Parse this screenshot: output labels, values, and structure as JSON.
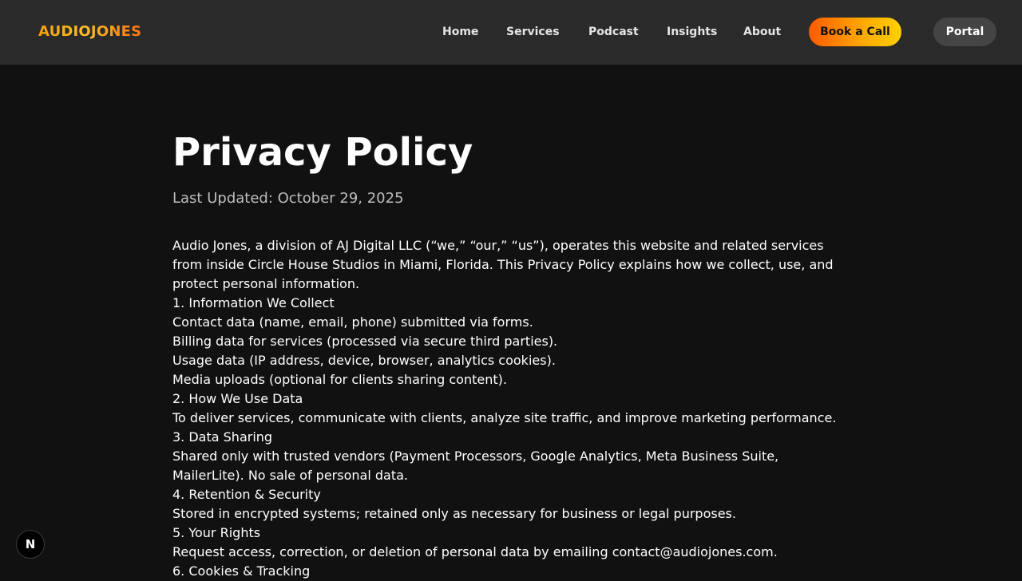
{
  "header": {
    "logo": "AUDIOJONES",
    "nav": {
      "home": "Home",
      "services": "Services",
      "podcast": "Podcast",
      "insights": "Insights",
      "about": "About"
    },
    "book_call": "Book a Call",
    "portal": "Portal"
  },
  "page": {
    "title": "Privacy Policy",
    "last_updated": "Last Updated: October 29, 2025",
    "intro": "Audio Jones, a division of AJ Digital LLC (“we,” “our,” “us”), operates this website and related services from inside Circle House Studios in Miami, Florida. This Privacy Policy explains how we collect, use, and protect personal information.",
    "s1_heading": "1. Information We Collect",
    "s1_line1": "Contact data (name, email, phone) submitted via forms.",
    "s1_line2": "Billing data for services (processed via secure third parties).",
    "s1_line3": "Usage data (IP address, device, browser, analytics cookies).",
    "s1_line4": "Media uploads (optional for clients sharing content).",
    "s2_heading": "2. How We Use Data",
    "s2_body": "To deliver services, communicate with clients, analyze site traffic, and improve marketing performance.",
    "s3_heading": "3. Data Sharing",
    "s3_body": "Shared only with trusted vendors (Payment Processors, Google Analytics, Meta Business Suite, MailerLite). No sale of personal data.",
    "s4_heading": "4. Retention & Security",
    "s4_body": "Stored in encrypted systems; retained only as necessary for business or legal purposes.",
    "s5_heading": "5. Your Rights",
    "s5_body": "Request access, correction, or deletion of personal data by emailing contact@audiojones.com.",
    "s6_heading": "6. Cookies & Tracking"
  },
  "dev_badge": "N",
  "colors": {
    "background": "#111111",
    "navbar": "#2b2b2b",
    "book_gradient_start": "#ff5a00",
    "book_gradient_end": "#ffd100",
    "portal_bg": "#444444"
  }
}
